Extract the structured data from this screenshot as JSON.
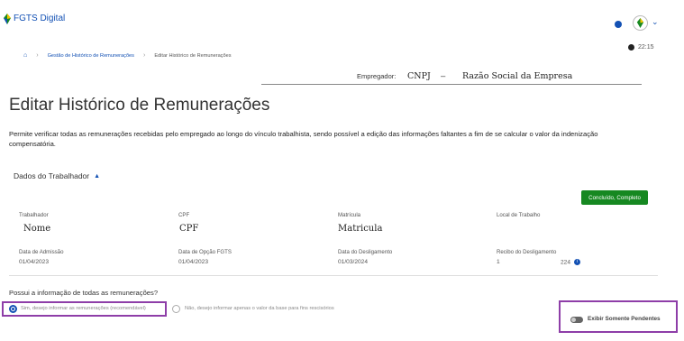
{
  "header": {
    "brand_name": "FGTS Digital",
    "timer": "22:15"
  },
  "breadcrumb": {
    "items": [
      "Gestão de Histórico de Remunerações",
      "Editar Histórico de Remunerações"
    ]
  },
  "empregador": {
    "label": "Empregador:",
    "cnpj": "CNPJ",
    "dash": "–",
    "razao_social": "Razão Social da Empresa"
  },
  "page": {
    "title": "Editar Histórico de Remunerações",
    "description": "Permite verificar todas as remunerações recebidas pelo empregado ao longo do vínculo trabalhista, sendo possível a edição das informações faltantes a fim de se calcular o valor da indenização compensatória."
  },
  "section": {
    "title": "Dados do Trabalhador",
    "status": "Concluído, Completo"
  },
  "worker": {
    "trabalhador_label": "Trabalhador",
    "trabalhador_value": "Nome",
    "cpf_label": "CPF",
    "cpf_value": "CPF",
    "matricula_label": "Matrícula",
    "matricula_value": "Matricula",
    "local_label": "Local de Trabalho",
    "admissao_label": "Data de Admissão",
    "admissao_value": "01/04/2023",
    "opcao_label": "Data de Opção FGTS",
    "opcao_value": "01/04/2023",
    "desligamento_label": "Data do Desligamento",
    "desligamento_value": "01/03/2024",
    "recibo_label": "Recibo do Desligamento",
    "recibo_value_1": "1",
    "recibo_value_2": "224"
  },
  "question": {
    "text": "Possui a informação de todas as remunerações?",
    "option_yes": "Sim, desejo informar as remunerações (recomendável)",
    "option_no": "Não, desejo informar apenas o valor da base para fins rescisórios"
  },
  "filter": {
    "toggle_label": "Exibir Somente Pendentes"
  },
  "colors": {
    "primary": "#1351b4",
    "success": "#168821",
    "highlight": "#8e3ea8"
  }
}
